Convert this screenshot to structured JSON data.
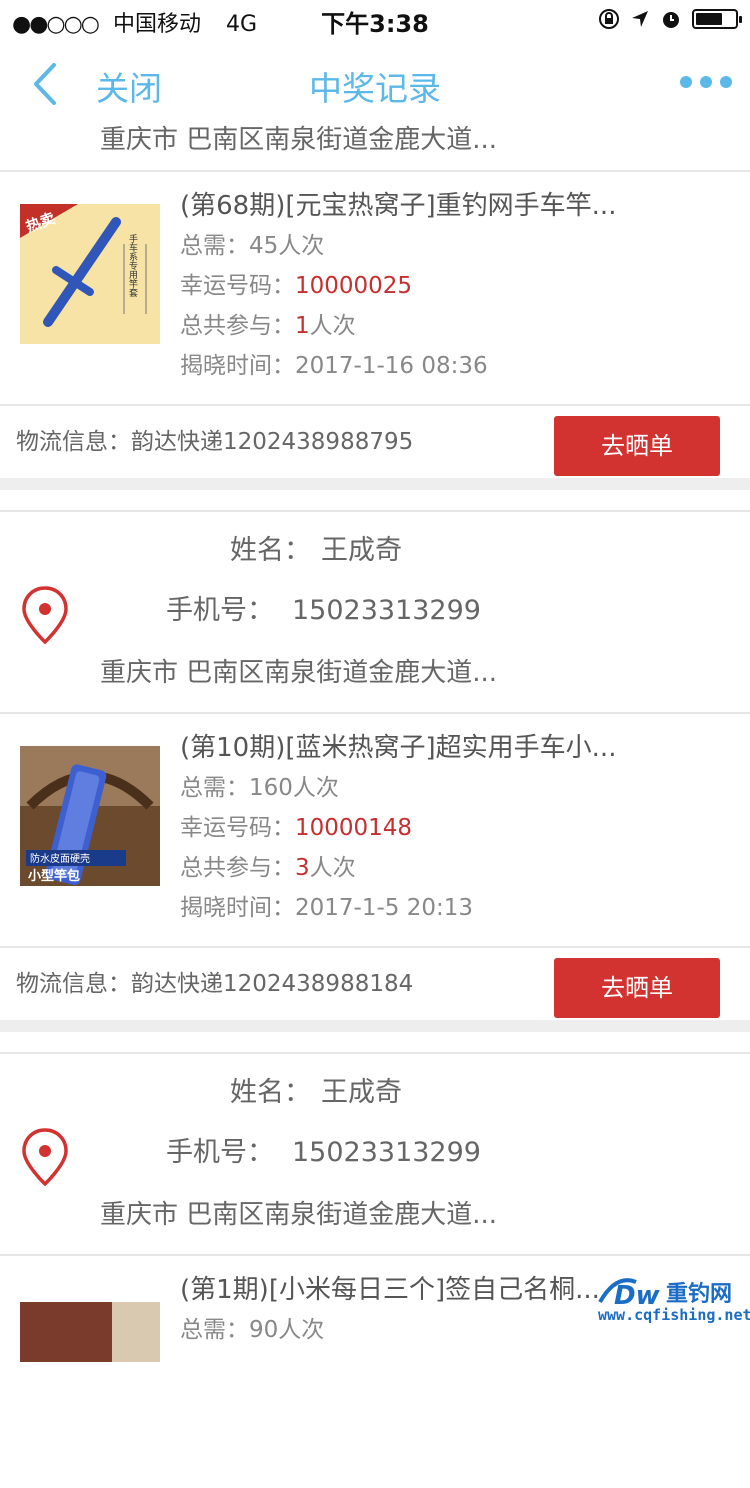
{
  "status_bar": {
    "signal": "●●○○○",
    "carrier": "中国移动",
    "network": "4G",
    "time": "下午3:38"
  },
  "nav": {
    "close_label": "关闭",
    "title": "中奖记录"
  },
  "top_address": "重庆市 巴南区南泉街道金鹿大道...",
  "orders": [
    {
      "title": "(第68期)[元宝热窝子]重钓网手车竿...",
      "total_label": "总需：",
      "total_value": "45人次",
      "lucky_label": "幸运号码：",
      "lucky_value": "10000025",
      "joined_label": "总共参与：",
      "joined_count": "1",
      "joined_unit": "人次",
      "reveal_label": "揭晓时间：",
      "reveal_value": "2017-1-16 08:36",
      "logistics": "物流信息：韵达快递1202438988795",
      "button": "去晒单"
    },
    {
      "title": "(第10期)[蓝米热窝子]超实用手车小...",
      "total_label": "总需：",
      "total_value": "160人次",
      "lucky_label": "幸运号码：",
      "lucky_value": "10000148",
      "joined_label": "总共参与：",
      "joined_count": "3",
      "joined_unit": "人次",
      "reveal_label": "揭晓时间：",
      "reveal_value": "2017-1-5 20:13",
      "logistics": "物流信息：韵达快递1202438988184",
      "button": "去晒单"
    },
    {
      "title": "(第1期)[小米每日三个]签自己名桐...",
      "total_label": "总需：",
      "total_value": "90人次"
    }
  ],
  "recipient": {
    "name_label": "姓名：",
    "name": "王成奇",
    "phone_label": "手机号：",
    "phone": "15023313299",
    "address": "重庆市 巴南区南泉街道金鹿大道..."
  },
  "thumb_text": {
    "hot": "热卖",
    "side": "手车系专用竿套",
    "bottom1": "防水皮面硬壳",
    "bottom2": "小型竿包"
  },
  "watermark": {
    "name": "重钓网",
    "url": "www.cqfishing.net"
  },
  "colors": {
    "accent": "#5bb8e8",
    "red": "#c62f2f",
    "button": "#d23230"
  }
}
